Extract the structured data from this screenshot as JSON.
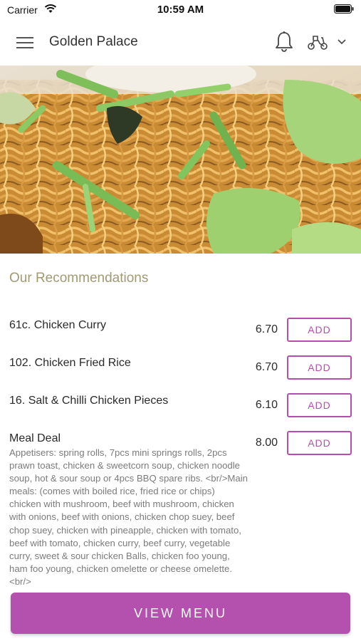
{
  "status_bar": {
    "carrier": "Carrier",
    "time": "10:59 AM",
    "icons": [
      "wifi-icon",
      "battery-icon"
    ]
  },
  "nav": {
    "title": "Golden Palace",
    "icons": [
      "menu-icon",
      "bell-icon",
      "scooter-icon",
      "chevron-down-icon"
    ]
  },
  "hero": {
    "image": "noodles-photo"
  },
  "recommendations": {
    "title": "Our Recommendations",
    "items": [
      {
        "name": "61c. Chicken Curry",
        "price": "6.70",
        "button": "ADD"
      },
      {
        "name": "102. Chicken Fried Rice",
        "price": "6.70",
        "button": "ADD"
      },
      {
        "name": "16. Salt & Chilli Chicken Pieces",
        "price": "6.10",
        "button": "ADD"
      },
      {
        "name": "Meal Deal",
        "price": "8.00",
        "button": "ADD",
        "description": "Appetisers: spring rolls, 7pcs mini springs rolls, 2pcs prawn toast, chicken & sweetcorn soup, chicken noodle soup, hot & sour soup or 4pcs BBQ spare ribs. <br/>Main meals: (comes with boiled rice, fried rice or chips) chicken with mushroom, beef with mushroom, chicken with onions, beef with onions, chicken chop suey, beef chop suey, chicken with pineapple, chicken with tomato, beef with tomato, chicken curry, beef curry, vegetable curry, sweet & sour chicken Balls, chicken foo young, ham foo young, chicken omelette or cheese omelette. <br/>"
      }
    ]
  },
  "footer": {
    "view_menu_label": "VIEW MENU"
  },
  "colors": {
    "accent": "#b450ad",
    "section_title": "#a29a72"
  }
}
